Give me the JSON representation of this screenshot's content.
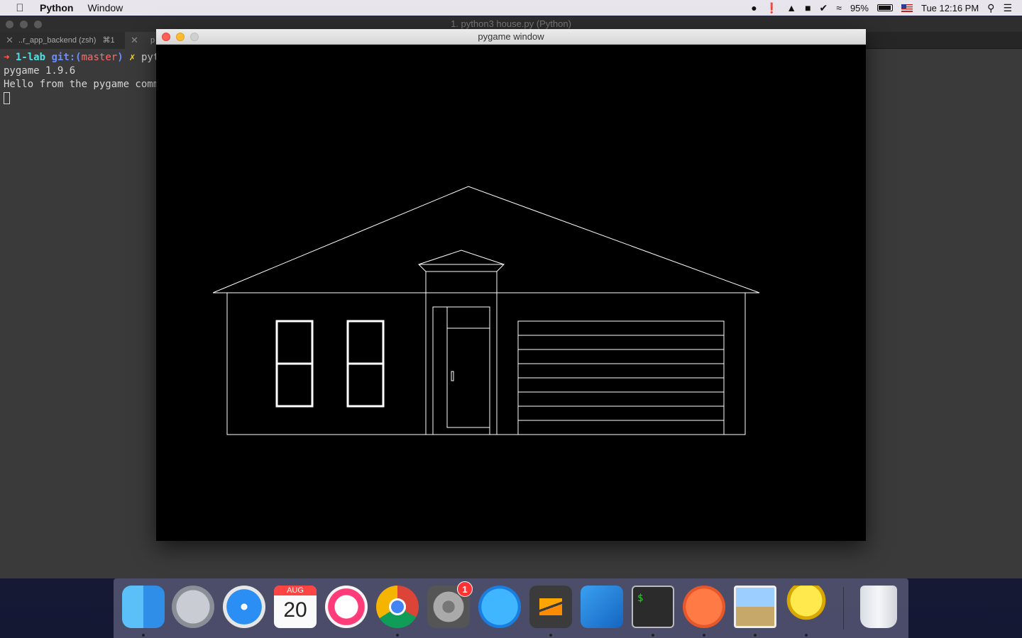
{
  "menubar": {
    "app_name": "Python",
    "menus": [
      "Window"
    ],
    "battery": "95%",
    "clock": "Tue 12:16 PM"
  },
  "terminal": {
    "title": "1. python3 house.py (Python)",
    "tabs": [
      {
        "label": "..r_app_backend (zsh)",
        "shortcut": "⌘1"
      },
      {
        "label": "p"
      }
    ],
    "prompt": {
      "arrow": "➜",
      "dir": "1-lab",
      "git_prefix": "git:(",
      "branch": "master",
      "git_suffix": ")",
      "dirty": "✗",
      "command": "pyt"
    },
    "output": [
      "pygame 1.9.6",
      "Hello from the pygame commu"
    ]
  },
  "pygame_window": {
    "title": "pygame window"
  },
  "colors": {
    "terminal_bg": "#3a3a3a",
    "canvas_bg": "#000000",
    "stroke": "#ffffff",
    "close": "#ff5f57",
    "minimize": "#febc2e"
  },
  "dock": {
    "calendar_month": "AUG",
    "calendar_day": "20",
    "system_prefs_badge": "1",
    "items": [
      "finder-icon",
      "launchpad-icon",
      "safari-icon",
      "calendar-icon",
      "music-icon",
      "chrome-icon",
      "system-preferences-icon",
      "app-store-icon",
      "sublime-text-icon",
      "vscode-icon",
      "terminal-icon",
      "postman-icon",
      "preview-icon",
      "pygame-icon",
      "trash-icon"
    ]
  }
}
